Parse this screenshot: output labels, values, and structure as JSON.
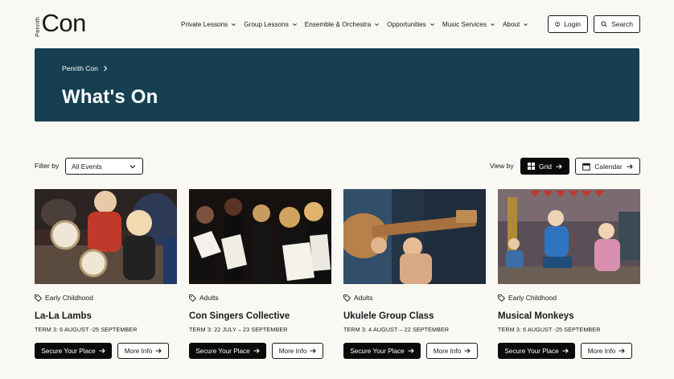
{
  "logo": {
    "small": "Penrith",
    "big": "Con"
  },
  "nav": {
    "items": [
      {
        "label": "Private Lessons"
      },
      {
        "label": "Group Lessons"
      },
      {
        "label": "Ensemble & Orchestra"
      },
      {
        "label": "Opportunities"
      },
      {
        "label": "Music Services"
      },
      {
        "label": "About"
      }
    ],
    "login_label": "Login",
    "search_label": "Search"
  },
  "hero": {
    "breadcrumb": "Penrith Con",
    "title": "What's On"
  },
  "filters": {
    "filter_label": "Filter by",
    "filter_value": "All Events",
    "view_label": "View by",
    "grid_label": "Grid",
    "calendar_label": "Calendar"
  },
  "cards": [
    {
      "tag": "Early Childhood",
      "title": "La-La Lambs",
      "date": "TERM 3: 6 AUGUST -25 SEPTEMBER",
      "secure": "Secure Your Place",
      "more": "More Info"
    },
    {
      "tag": "Adults",
      "title": "Con Singers Collective",
      "date": "TERM 3: 22 JULY – 23 SEPTEMBER",
      "secure": "Secure Your Place",
      "more": "More Info"
    },
    {
      "tag": "Adults",
      "title": "Ukulele Group Class",
      "date": "TERM 3: 4 AUGUST – 22 SEPTEMBER",
      "secure": "Secure Your Place",
      "more": "More Info"
    },
    {
      "tag": "Early Childhood",
      "title": "Musical Monkeys",
      "date": "TERM 3: 6 AUGUST -25 SEPTEMBER",
      "secure": "Secure Your Place",
      "more": "More Info"
    }
  ],
  "colors": {
    "hero_bg": "#163f52",
    "page_bg": "#faf8f3",
    "button_dark": "#0b0b0b"
  }
}
